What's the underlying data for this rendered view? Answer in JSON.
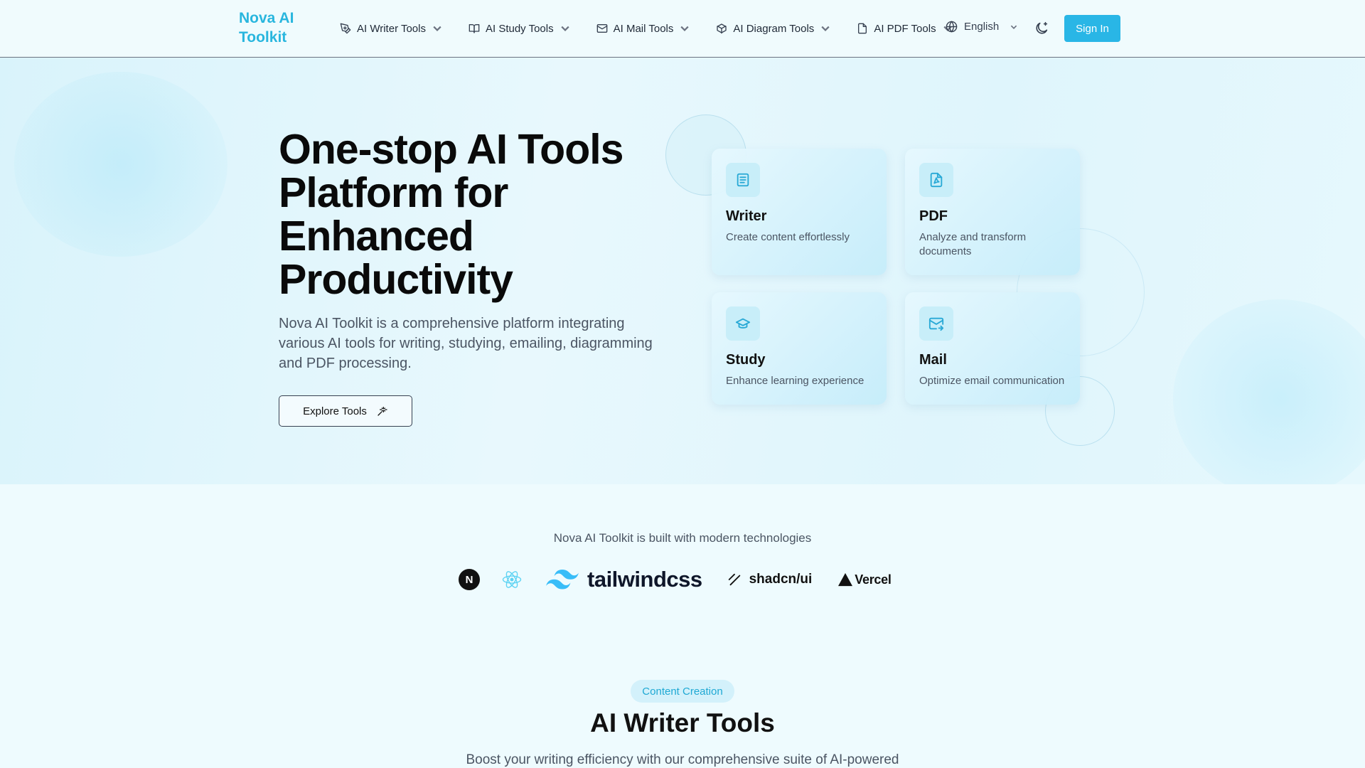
{
  "nav": {
    "brand": "Nova AI Toolkit",
    "items": [
      {
        "label": "AI Writer Tools",
        "icon": "pen-icon"
      },
      {
        "label": "AI Study Tools",
        "icon": "book-icon"
      },
      {
        "label": "AI Mail Tools",
        "icon": "mail-icon"
      },
      {
        "label": "AI Diagram Tools",
        "icon": "box-icon"
      },
      {
        "label": "AI PDF Tools",
        "icon": "file-icon"
      }
    ],
    "language": "English",
    "theme_toggle_icon": "moon-icon",
    "sign_in": "Sign In"
  },
  "hero": {
    "title": "One-stop AI Tools Platform for Enhanced Productivity",
    "description": "Nova AI Toolkit is a comprehensive platform integrating various AI tools for writing, studying, emailing, diagramming and PDF processing.",
    "cta": "Explore Tools",
    "cards": [
      {
        "title": "Writer",
        "desc": "Create content effortlessly",
        "icon": "document-lines-icon"
      },
      {
        "title": "PDF",
        "desc": "Analyze and transform documents",
        "icon": "pdf-file-icon"
      },
      {
        "title": "Study",
        "desc": "Enhance learning experience",
        "icon": "graduation-cap-icon"
      },
      {
        "title": "Mail",
        "desc": "Optimize email communication",
        "icon": "mail-send-icon"
      }
    ]
  },
  "tech": {
    "caption": "Nova AI Toolkit is built with modern technologies",
    "next_letter": "N",
    "tailwind": "tailwindcss",
    "shadcn": "shadcn/ui",
    "vercel": "Vercel"
  },
  "section": {
    "badge": "Content Creation",
    "title": "AI Writer Tools",
    "description": "Boost your writing efficiency with our comprehensive suite of AI-powered"
  },
  "colors": {
    "accent": "#29b6e6",
    "background": "#eefbfe"
  }
}
